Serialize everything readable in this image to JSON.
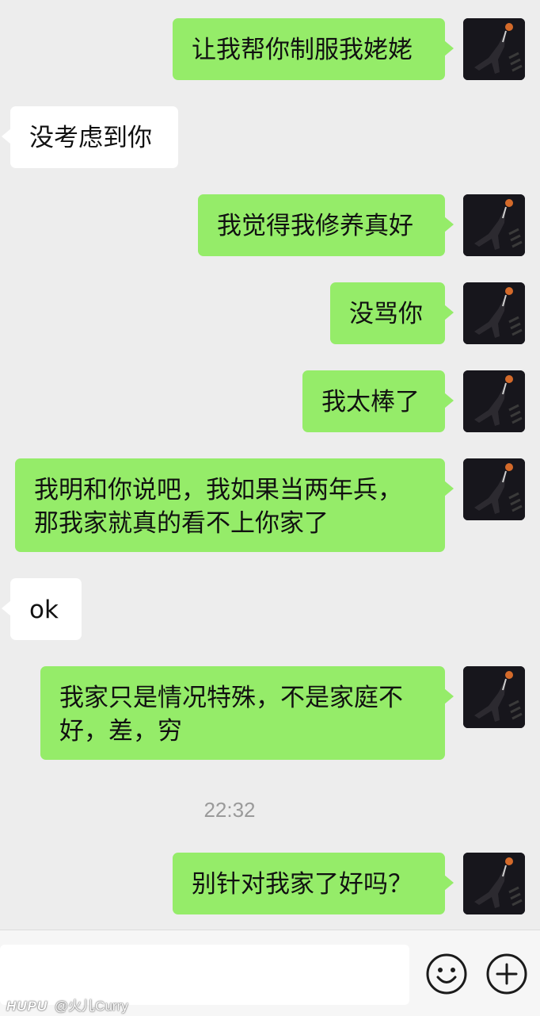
{
  "messages": [
    {
      "side": "out",
      "text": "让我帮你制服我姥姥"
    },
    {
      "side": "in",
      "text": "没考虑到你"
    },
    {
      "side": "out",
      "text": "我觉得我修养真好"
    },
    {
      "side": "out",
      "text": "没骂你"
    },
    {
      "side": "out",
      "text": "我太棒了"
    },
    {
      "side": "out",
      "text": "我明和你说吧，我如果当两年兵，\n那我家就真的看不上你家了"
    },
    {
      "side": "in",
      "text": "ok"
    },
    {
      "side": "out",
      "text": "我家只是情况特殊，不是家庭不\n好，差，穷"
    },
    {
      "side": "out",
      "text": "别针对我家了好吗？"
    }
  ],
  "timestamp": "22:32",
  "input": {
    "value": "",
    "placeholder": ""
  },
  "icons": {
    "emoji": "smiley-face-icon",
    "more": "plus-circle-icon"
  },
  "watermark": {
    "brand": "HUPU",
    "user": "@火儿Curry"
  },
  "colors": {
    "background": "#ededed",
    "outgoing_bubble": "#95ec69",
    "incoming_bubble": "#ffffff",
    "timestamp": "#9a9a9a"
  }
}
